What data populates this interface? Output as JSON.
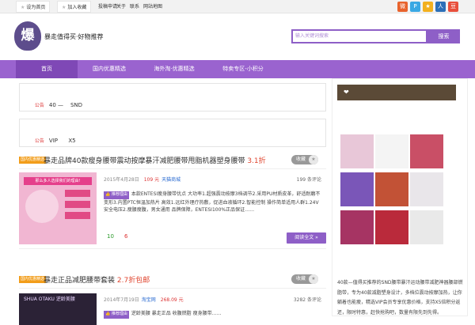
{
  "topbar": {
    "tabs": [
      "设为首页",
      "加入收藏"
    ],
    "links": [
      "投稿申请",
      "关于",
      "联系",
      "网站地图"
    ],
    "social": [
      {
        "name": "weibo-icon",
        "glyph": "微",
        "color": "#e8632d"
      },
      {
        "name": "tencent-weibo-icon",
        "glyph": "P",
        "color": "#39a8e3"
      },
      {
        "name": "qzone-icon",
        "glyph": "★",
        "color": "#f2b01e"
      },
      {
        "name": "renren-icon",
        "glyph": "人",
        "color": "#2c6fb8"
      },
      {
        "name": "douban-icon",
        "glyph": "豆",
        "color": "#e84f3c"
      }
    ]
  },
  "header": {
    "logo_char": "爆",
    "site_name": "暴走值得买·好物推荐",
    "search_placeholder": "输入关键词搜索",
    "search_button": "搜索"
  },
  "nav": [
    "首页",
    "国内优惠精选",
    "海外淘·优惠精选",
    "特卖专区-小积分"
  ],
  "notices": [
    {
      "tag": "公告",
      "text": "40 —    SND"
    },
    {
      "tag": "公告",
      "text": "VIP      X5"
    }
  ],
  "sidebar": {
    "title_icon": "❤",
    "description": "40款—值得买推荐的SND腰带暴汗运动腰带减肥神器腰部燃脂带，专为40款减脂塑身设计，多档位震动按摩加热，让你躺着也能瘦，精选VIP会员专享优惠价格，支持X5倍积分返还，限时特惠，赶快抢购吧，数量有限先到先得。",
    "thumbs": [
      {
        "name": "product-thumb-1",
        "bg": "#e8c7d8"
      },
      {
        "name": "product-thumb-2",
        "bg": "#f4f4f4"
      },
      {
        "name": "product-thumb-3",
        "bg": "#c94f66"
      },
      {
        "name": "product-thumb-4",
        "bg": "#7a56b8"
      },
      {
        "name": "product-thumb-5",
        "bg": "#c25236"
      },
      {
        "name": "product-thumb-6",
        "bg": "#e9e6ea"
      },
      {
        "name": "product-thumb-7",
        "bg": "#a63463"
      },
      {
        "name": "product-thumb-8",
        "bg": "#ba2a3b"
      },
      {
        "name": "product-thumb-9",
        "bg": "#e9e9e9"
      }
    ]
  },
  "articles": [
    {
      "category": "国内优惠精选",
      "title": "暴走品牌40款瘦身腰带震动按摩暴汗减肥腰带甩脂机器塑身腰带",
      "score": "3.1折",
      "fav": "收藏",
      "date": "2015年4月28日",
      "price": "109 元",
      "source": "天猫商城",
      "reviews": "199 条评论",
      "badge": "推荐理由",
      "recommend": "本款ENTESI瘦身腰带优点 大功率1.超强震动按摩3档调节2.采用PU材质皮革，舒适耐磨不变形3.内置PTC恒温加热片 高效1.远红外理疗热敷，促进血液循环2.智能控制 操作简单适用人群1.24V安全电压2.瘦腰瘦腹，男女通用 品牌保障，ENTESI100%正品保证……",
      "likes": "10",
      "dislikes": "6",
      "more": "阅读全文 »",
      "img_color": "#f1b6d2"
    },
    {
      "category": "国内优惠精选",
      "title": "暴走正品减肥腰带套装",
      "score": "2.7折包邮",
      "fav": "收藏",
      "date": "2014年7月19日",
      "price": "268.09 元",
      "source": "淘宝网",
      "reviews": "3282 条评论",
      "badge": "推荐理由",
      "recommend": "逆龄美腰 暴走正品 收腹燃脂 瘦身腰带……",
      "img_text": "SHUA OTAKU 逆龄美腰",
      "img_color": "#2b2236"
    }
  ]
}
